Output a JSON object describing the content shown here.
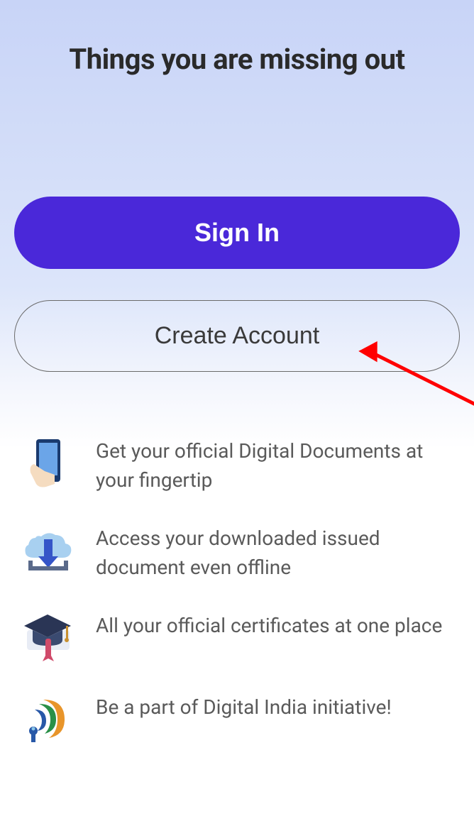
{
  "heading": "Things you are missing out",
  "buttons": {
    "sign_in": "Sign In",
    "create_account": "Create Account"
  },
  "features": [
    {
      "icon": "phone-hand-icon",
      "text": "Get your official Digital Documents at your fingertip"
    },
    {
      "icon": "cloud-download-icon",
      "text": "Access your downloaded issued document even offline"
    },
    {
      "icon": "graduation-cap-icon",
      "text": "All your official certificates at one place"
    },
    {
      "icon": "digital-india-icon",
      "text": "Be a part of Digital India initiative!"
    }
  ],
  "colors": {
    "primary": "#4a28d9",
    "text_dark": "#2a2a2a",
    "text_muted": "#5a5a5a"
  }
}
